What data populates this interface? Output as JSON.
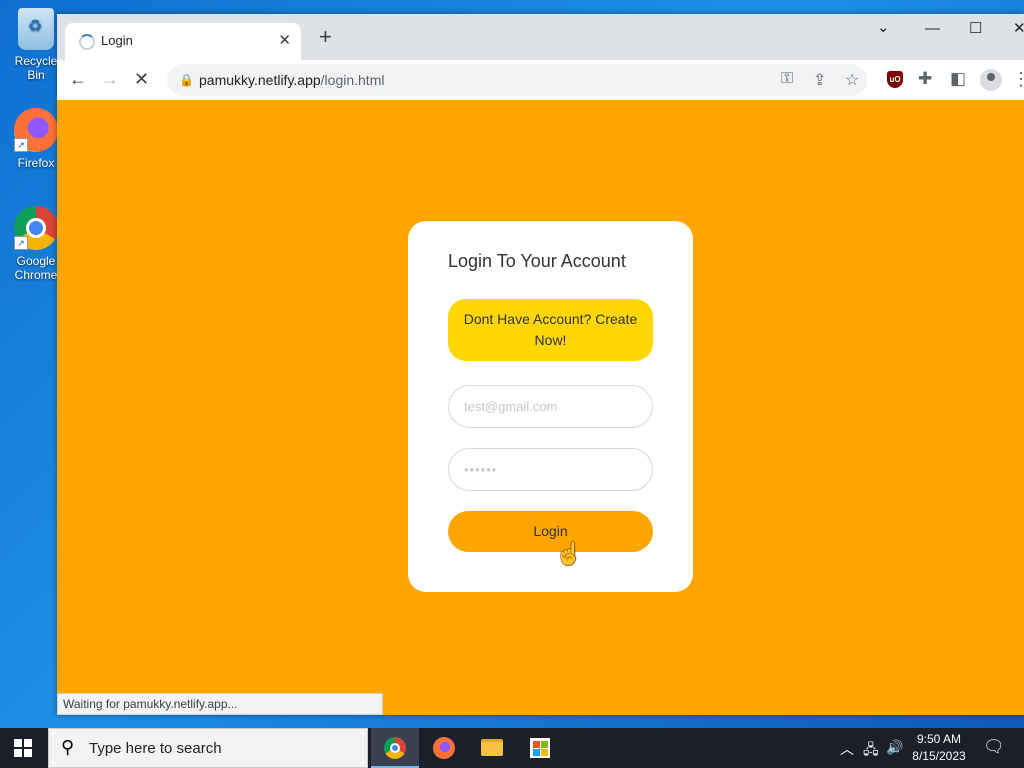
{
  "desktop": {
    "icons": [
      {
        "label": "Recycle Bin",
        "icon": "recycle-bin-icon"
      },
      {
        "label": "Firefox",
        "icon": "firefox-icon"
      },
      {
        "label": "Google Chrome",
        "icon": "chrome-icon"
      }
    ]
  },
  "browser": {
    "tab_title": "Login",
    "tab_close": "✕",
    "new_tab": "+",
    "url_host": "pamukky.netlify.app",
    "url_path": "/login.html",
    "status_text": "Waiting for pamukky.netlify.app..."
  },
  "page": {
    "heading": "Login To Your Account",
    "create_account": "Dont Have Account? Create Now!",
    "email_placeholder": "test@gmail.com",
    "password_value": "••••••",
    "login_label": "Login"
  },
  "taskbar": {
    "search_placeholder": "Type here to search",
    "time": "9:50 AM",
    "date": "8/15/2023"
  },
  "colors": {
    "page_bg": "#ffa500",
    "create_bg": "#ffd700",
    "login_bg": "#ffa500"
  }
}
